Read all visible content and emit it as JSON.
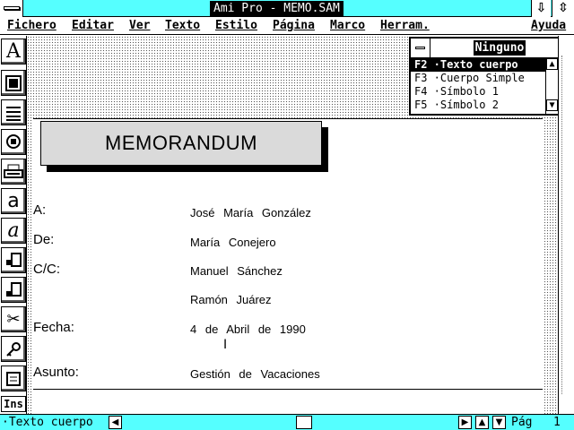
{
  "window": {
    "title": "Ami Pro - MEMO.SAM"
  },
  "menu": [
    "Fichero",
    "Editar",
    "Ver",
    "Texto",
    "Estilo",
    "Página",
    "Marco",
    "Herram.",
    "Ayuda"
  ],
  "toolbox": {
    "ins_label": "Ins"
  },
  "document": {
    "memo_title": "MEMORANDUM",
    "fields": [
      {
        "label": "A:",
        "value": "José María González"
      },
      {
        "label": "De:",
        "value": "María Conejero"
      },
      {
        "label": "C/C:",
        "value": "Manuel Sánchez"
      },
      {
        "label": "",
        "value": "Ramón Juárez"
      },
      {
        "label": "Fecha:",
        "value": "4 de Abril de 1990"
      },
      {
        "label": "Asunto:",
        "value": "Gestión de Vacaciones"
      }
    ]
  },
  "palette": {
    "title": "Ninguno",
    "items": [
      "F2 ·Texto cuerpo",
      "F3 ·Cuerpo Simple",
      "F4 ·Símbolo 1",
      "F5 ·Símbolo 2"
    ]
  },
  "status": {
    "style": "·Texto cuerpo",
    "page_label": "Pág",
    "page_number": "1"
  }
}
